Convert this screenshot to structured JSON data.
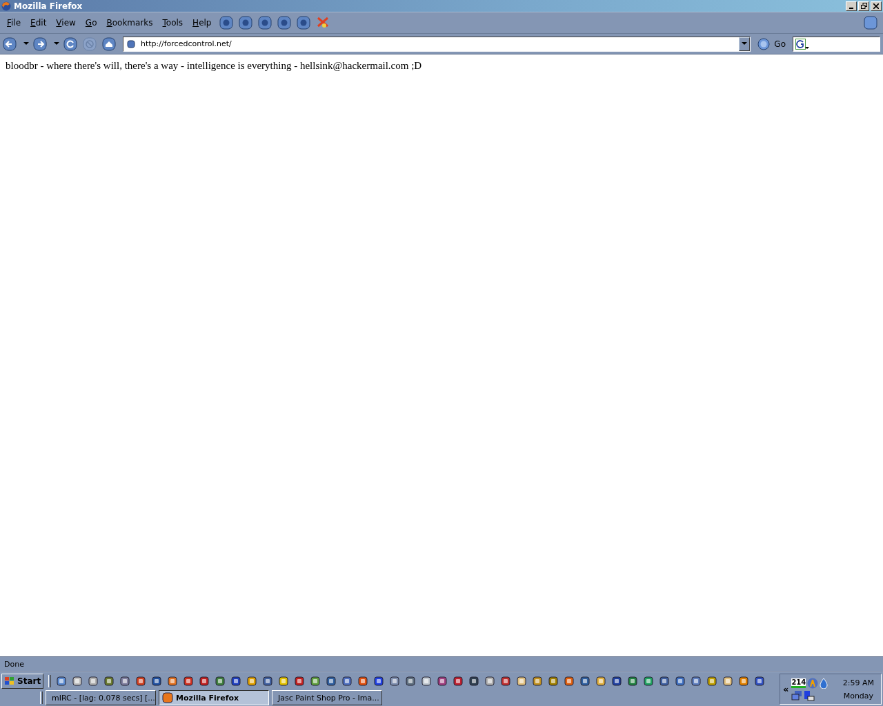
{
  "window": {
    "title": "Mozilla Firefox"
  },
  "menu": [
    "File",
    "Edit",
    "View",
    "Go",
    "Bookmarks",
    "Tools",
    "Help"
  ],
  "address": {
    "value": "http://forcedcontrol.net/"
  },
  "go_label": "Go",
  "page_text": "bloodbr - where there's will, there's a way - intelligence is everything - hellsink@hackermail.com ;D",
  "status_bar": "Done",
  "taskbar": {
    "start": "Start",
    "buttons": [
      {
        "label": "mIRC - [lag: 0.078 secs] [...",
        "selected": false
      },
      {
        "label": "Mozilla Firefox",
        "selected": true
      },
      {
        "label": "Jasc Paint Shop Pro - Ima...",
        "selected": false
      }
    ],
    "tray": {
      "expand": "«",
      "counter": "214",
      "time": "2:59 AM",
      "day": "Monday"
    }
  }
}
